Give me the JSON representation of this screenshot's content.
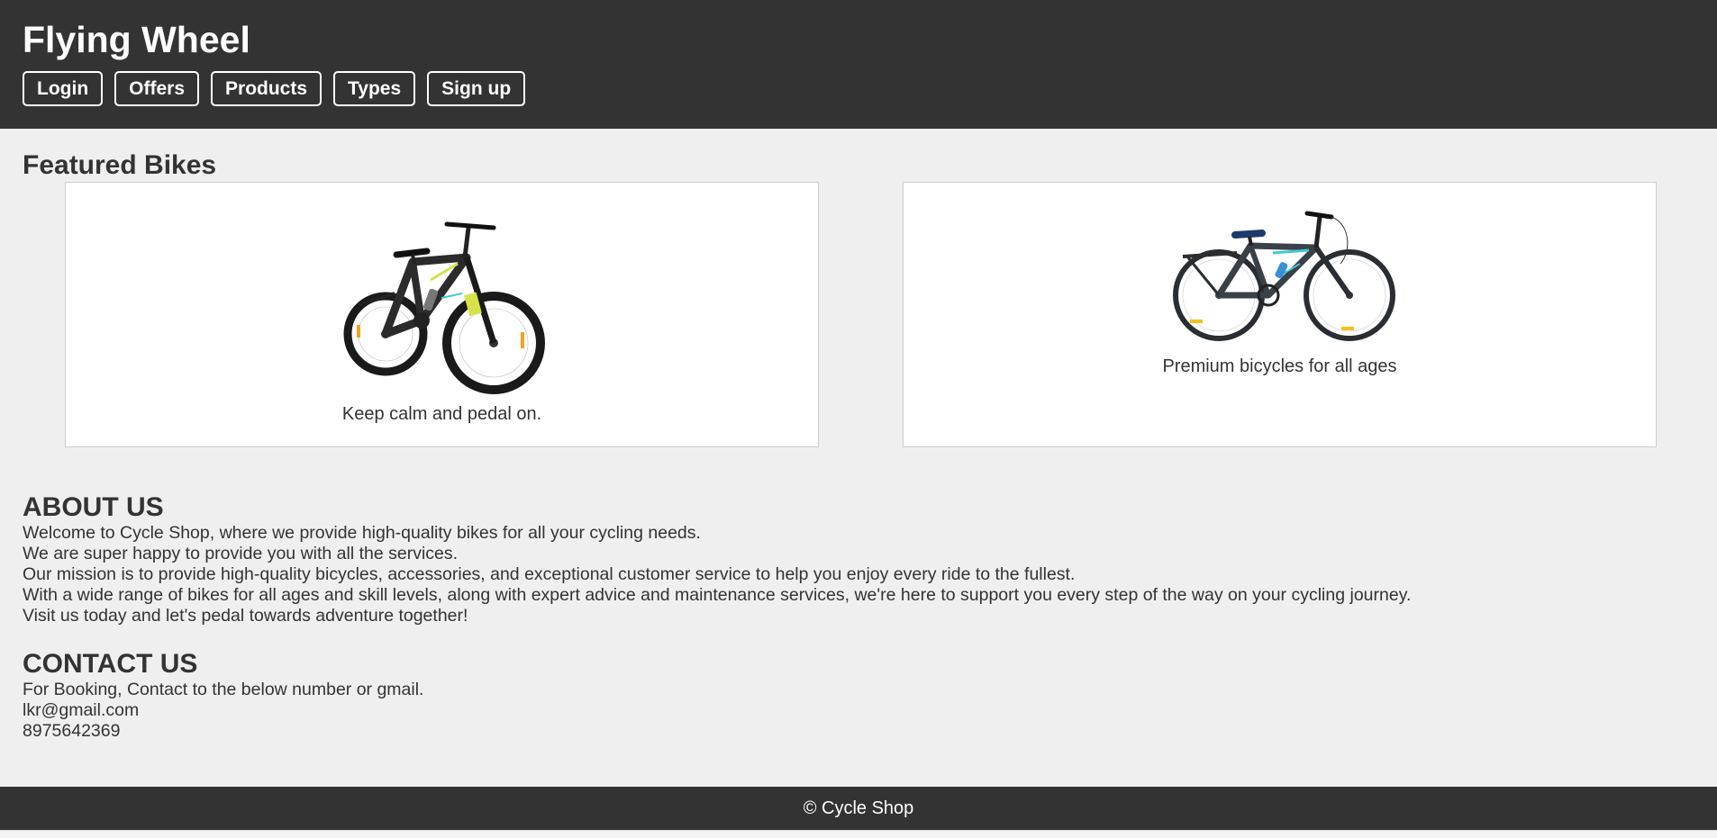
{
  "header": {
    "title": "Flying Wheel",
    "nav": [
      {
        "label": "Login"
      },
      {
        "label": "Offers"
      },
      {
        "label": "Products"
      },
      {
        "label": "Types"
      },
      {
        "label": "Sign up"
      }
    ]
  },
  "featured": {
    "title": "Featured Bikes",
    "cards": [
      {
        "caption": "Keep calm and pedal on.",
        "image": "mountain-bike-black-yellow"
      },
      {
        "caption": "Premium bicycles for all ages",
        "image": "city-bike-black-cyan"
      }
    ]
  },
  "about": {
    "title": "ABOUT US",
    "lines": [
      "Welcome to Cycle Shop, where we provide high-quality bikes for all your cycling needs.",
      "We are super happy to provide you with all the services.",
      "Our mission is to provide high-quality bicycles, accessories, and exceptional customer service to help you enjoy every ride to the fullest.",
      "With a wide range of bikes for all ages and skill levels, along with expert advice and maintenance services, we're here to support you every step of the way on your cycling journey.",
      "Visit us today and let's pedal towards adventure together!"
    ]
  },
  "contact": {
    "title": "CONTACT US",
    "lines": [
      "For Booking, Contact to the below number or gmail.",
      "lkr@gmail.com",
      "8975642369"
    ]
  },
  "footer": {
    "text": "© Cycle Shop"
  },
  "colors": {
    "header_bg": "#333333",
    "page_bg": "#efefef",
    "accent_yellow": "#d4e34a",
    "accent_cyan": "#3ec8d6"
  }
}
